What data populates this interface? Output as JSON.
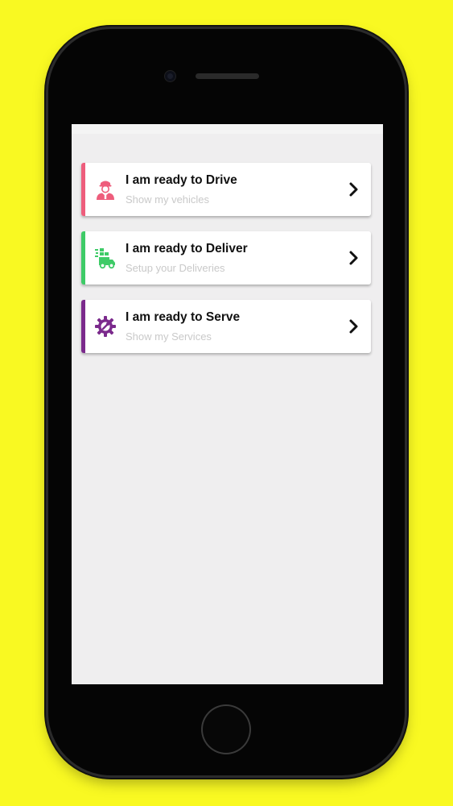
{
  "colors": {
    "background": "#f9f922",
    "drive_accent": "#ee5d7c",
    "deliver_accent": "#3ecb67",
    "serve_accent": "#7b2a8c"
  },
  "options": [
    {
      "title": "I am ready to Drive",
      "subtitle": "Show my vehicles",
      "icon": "driver-icon",
      "accent": "#ee5d7c"
    },
    {
      "title": "I am ready to Deliver",
      "subtitle": "Setup your Deliveries",
      "icon": "delivery-truck-icon",
      "accent": "#3ecb67"
    },
    {
      "title": "I am ready to Serve",
      "subtitle": "Show my Services",
      "icon": "wrench-gear-icon",
      "accent": "#7b2a8c"
    }
  ]
}
